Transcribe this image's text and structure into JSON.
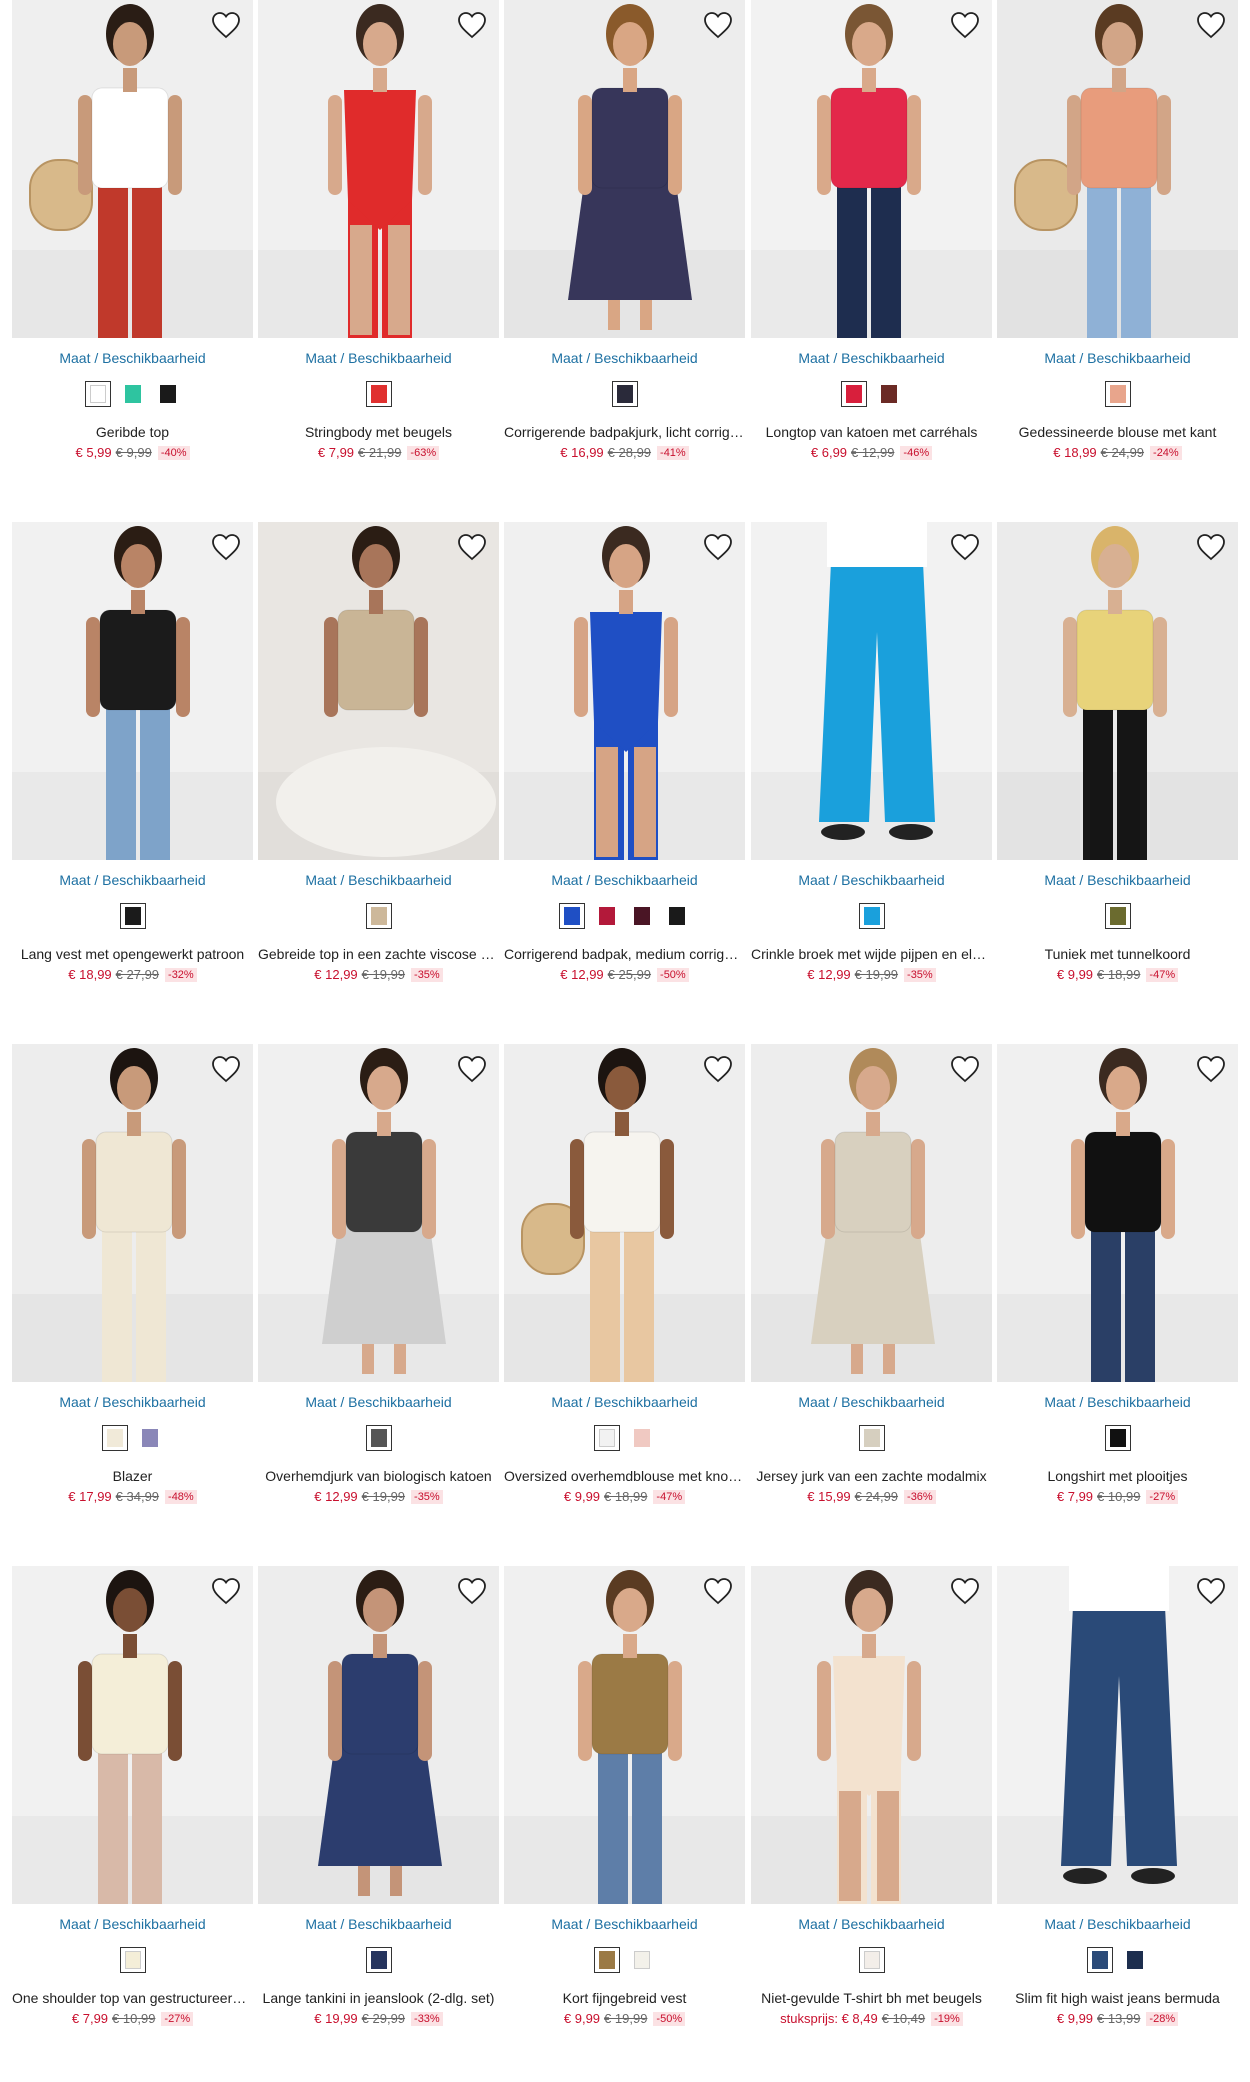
{
  "maat_label": "Maat / Beschikbaarheid",
  "products": [
    {
      "name": "Geribde top",
      "price": "€ 5,99",
      "old": "€ 9,99",
      "disc": "-40%",
      "swatches": [
        "#ffffff",
        "#2ec4a0",
        "#1a1a1a"
      ]
    },
    {
      "name": "Stringbody met beugels",
      "price": "€ 7,99",
      "old": "€ 21,99",
      "disc": "-63%",
      "swatches": [
        "#e0302f"
      ]
    },
    {
      "name": "Corrigerende badpakjurk, licht corrigerend",
      "price": "€ 16,99",
      "old": "€ 28,99",
      "disc": "-41%",
      "swatches": [
        "#2a2a3a"
      ]
    },
    {
      "name": "Longtop van katoen met carréhals",
      "price": "€ 6,99",
      "old": "€ 12,99",
      "disc": "-46%",
      "swatches": [
        "#d81f3c",
        "#6b2a25"
      ]
    },
    {
      "name": "Gedessineerde blouse met kant",
      "price": "€ 18,99",
      "old": "€ 24,99",
      "disc": "-24%",
      "swatches": [
        "#e8a58c"
      ]
    },
    {
      "name": "Lang vest met opengewerkt patroon",
      "price": "€ 18,99",
      "old": "€ 27,99",
      "disc": "-32%",
      "swatches": [
        "#1b1b1b"
      ]
    },
    {
      "name": "Gebreide top in een zachte viscose mix",
      "price": "€ 12,99",
      "old": "€ 19,99",
      "disc": "-35%",
      "swatches": [
        "#cdb89a"
      ]
    },
    {
      "name": "Corrigerend badpak, medium corrigerend",
      "price": "€ 12,99",
      "old": "€ 25,99",
      "disc": "-50%",
      "swatches": [
        "#1f4fc4",
        "#b3193a",
        "#4a1525",
        "#1a1a1a"
      ]
    },
    {
      "name": "Crinkle broek met wijde pijpen en elastische band",
      "price": "€ 12,99",
      "old": "€ 19,99",
      "disc": "-35%",
      "swatches": [
        "#1aa0dc"
      ]
    },
    {
      "name": "Tuniek met tunnelkoord",
      "price": "€ 9,99",
      "old": "€ 18,99",
      "disc": "-47%",
      "swatches": [
        "#6b6b2f"
      ]
    },
    {
      "name": "Blazer",
      "price": "€ 17,99",
      "old": "€ 34,99",
      "disc": "-48%",
      "swatches": [
        "#f1ead9",
        "#8a87b8"
      ]
    },
    {
      "name": "Overhemdjurk van biologisch katoen",
      "price": "€ 12,99",
      "old": "€ 19,99",
      "disc": "-35%",
      "swatches": [
        "#555555"
      ]
    },
    {
      "name": "Oversized overhemdblouse met knoopsluiting",
      "price": "€ 9,99",
      "old": "€ 18,99",
      "disc": "-47%",
      "swatches": [
        "#f2f2f2",
        "#f0c9c2"
      ]
    },
    {
      "name": "Jersey jurk van een zachte modalmix",
      "price": "€ 15,99",
      "old": "€ 24,99",
      "disc": "-36%",
      "swatches": [
        "#d6cfbf"
      ]
    },
    {
      "name": "Longshirt met plooitjes",
      "price": "€ 7,99",
      "old": "€ 10,99",
      "disc": "-27%",
      "swatches": [
        "#111111"
      ]
    },
    {
      "name": "One shoulder top van gestructureerde stof",
      "price": "€ 7,99",
      "old": "€ 10,99",
      "disc": "-27%",
      "swatches": [
        "#f4eed8"
      ]
    },
    {
      "name": "Lange tankini in jeanslook (2-dlg. set)",
      "price": "€ 19,99",
      "old": "€ 29,99",
      "disc": "-33%",
      "swatches": [
        "#26345e"
      ]
    },
    {
      "name": "Kort fijngebreid vest",
      "price": "€ 9,99",
      "old": "€ 19,99",
      "disc": "-50%",
      "swatches": [
        "#9b7a45",
        "#f3f1ea"
      ]
    },
    {
      "name": "Niet-gevulde T-shirt bh met beugels",
      "prefix": "stuksprijs:",
      "price": "€ 8,49",
      "old": "€ 10,49",
      "disc": "-19%",
      "swatches": [
        "#f3eee9"
      ]
    },
    {
      "name": "Slim fit high waist jeans bermuda",
      "price": "€ 9,99",
      "old": "€ 13,99",
      "disc": "-28%",
      "swatches": [
        "#2a4a78",
        "#1d2e4e"
      ]
    }
  ],
  "photos": [
    {
      "bg": "#efefef",
      "top": "#ffffff",
      "bottom": "#c0392b",
      "skin": "#c89a7a",
      "hair": "#2a1d15",
      "prop": "chair"
    },
    {
      "bg": "#f0f0f0",
      "top": "#e02b2b",
      "bottom": "#e02b2b",
      "skin": "#d7a98c",
      "hair": "#3b2a20",
      "prop": "body"
    },
    {
      "bg": "#ededed",
      "top": "#37365a",
      "bottom": "#37365a",
      "skin": "#d9a684",
      "hair": "#8a5a2b",
      "prop": "dress"
    },
    {
      "bg": "#f2f2f2",
      "top": "#e3284a",
      "bottom": "#1e2d4f",
      "skin": "#d9a98a",
      "hair": "#7a5634",
      "prop": "none"
    },
    {
      "bg": "#eaeaea",
      "top": "#e89c7c",
      "bottom": "#8fb1d6",
      "skin": "#d2a587",
      "hair": "#5a3b22",
      "prop": "chair"
    },
    {
      "bg": "#f1f1f1",
      "top": "#1b1b1b",
      "bottom": "#7ea3c9",
      "skin": "#b98466",
      "hair": "#2b1d14",
      "prop": "none"
    },
    {
      "bg": "#e9e6e2",
      "top": "#c9b596",
      "bottom": "#f2f0ec",
      "skin": "#a8755a",
      "hair": "#2b1d14",
      "prop": "sit"
    },
    {
      "bg": "#f0f0f0",
      "top": "#1f4fc4",
      "bottom": "#1f4fc4",
      "skin": "#d6a485",
      "hair": "#3b2a20",
      "prop": "body"
    },
    {
      "bg": "#f2f2f2",
      "top": "#ffffff",
      "bottom": "#1aa0dc",
      "skin": "#d9a98a",
      "hair": "#f2f2f2",
      "prop": "pants"
    },
    {
      "bg": "#ebebeb",
      "top": "#e8d37a",
      "bottom": "#151515",
      "skin": "#d8b092",
      "hair": "#d9b46a",
      "prop": "none"
    },
    {
      "bg": "#ededed",
      "top": "#efe7d4",
      "bottom": "#efe7d4",
      "skin": "#c89a7a",
      "hair": "#1c1410",
      "prop": "none"
    },
    {
      "bg": "#f0f0f0",
      "top": "#3a3a3a",
      "bottom": "#cfcfcf",
      "skin": "#d7a98c",
      "hair": "#2b1d14",
      "prop": "dress"
    },
    {
      "bg": "#eeeeee",
      "top": "#f6f4ef",
      "bottom": "#e8c7a1",
      "skin": "#8a5a3c",
      "hair": "#1c1410",
      "prop": "chair"
    },
    {
      "bg": "#ededed",
      "top": "#d8d0bf",
      "bottom": "#d8d0bf",
      "skin": "#d7a98c",
      "hair": "#b08a5a",
      "prop": "dress"
    },
    {
      "bg": "#f0f0f0",
      "top": "#111111",
      "bottom": "#2a3f66",
      "skin": "#d9a98a",
      "hair": "#3b2a20",
      "prop": "none"
    },
    {
      "bg": "#f1f1f1",
      "top": "#f4eed8",
      "bottom": "#d8b9a8",
      "skin": "#7a4e35",
      "hair": "#1c1410",
      "prop": "none"
    },
    {
      "bg": "#ededed",
      "top": "#2c3d6e",
      "bottom": "#2c3d6e",
      "skin": "#c49478",
      "hair": "#2b1d14",
      "prop": "dress"
    },
    {
      "bg": "#f0f0f0",
      "top": "#9b7a45",
      "bottom": "#5e7ea8",
      "skin": "#d9a98a",
      "hair": "#5a3b22",
      "prop": "none"
    },
    {
      "bg": "#eeeeee",
      "top": "#f3e2cf",
      "bottom": "#f3e2cf",
      "skin": "#d7a98c",
      "hair": "#3b2a20",
      "prop": "body"
    },
    {
      "bg": "#f2f2f2",
      "top": "#ffffff",
      "bottom": "#2a4a78",
      "skin": "#d9a98a",
      "hair": "#f2f2f2",
      "prop": "pants"
    }
  ]
}
